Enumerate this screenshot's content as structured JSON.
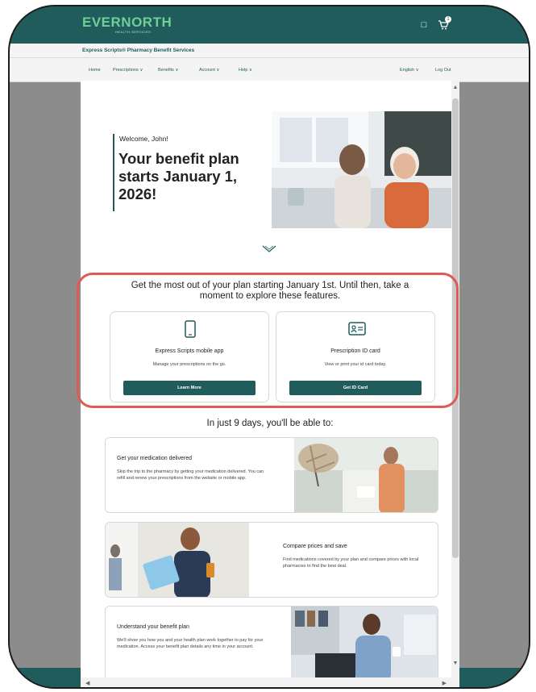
{
  "header": {
    "logo": "EVERNORTH",
    "logo_sub": "HEALTH SERVICES",
    "brand": "Express Scripts® Pharmacy Benefit Services",
    "nav": [
      "Home",
      "Prescriptions ∨",
      "Benefits ∨",
      "Account ∨",
      "Help ∨"
    ],
    "language": "English ∨",
    "logout": "Log Out",
    "icons": [
      "bell-icon",
      "cart-icon"
    ]
  },
  "hero": {
    "welcome": "Welcome, John!",
    "headline": "Your benefit plan starts January 1, 2026!"
  },
  "explore": {
    "text": "Get the most out of your plan starting January 1st. Until then, take a moment to explore these features."
  },
  "cards": [
    {
      "icon": "phone-icon",
      "title": "Express Scripts mobile app",
      "desc": "Manage your prescriptions on the go.",
      "button": "Learn More"
    },
    {
      "icon": "id-card-icon",
      "title": "Prescription ID card",
      "desc": "View or print your id card today.",
      "button": "Get ID Card"
    }
  ],
  "countdown": {
    "text": "In just 9 days, you'll be able to:"
  },
  "features": [
    {
      "title": "Get your medication delivered",
      "desc": "Skip the trip to the pharmacy by getting your medication delivered. You can refill and renew your prescriptions from the website or mobile app."
    },
    {
      "title": "Compare prices and save",
      "desc": "Find medications covered by your plan and compare prices with local pharmacies to find the best deal."
    },
    {
      "title": "Understand your benefit plan",
      "desc": "We'll show you how you and your health plan work together to pay for your medication. Access your benefit plan details any time in your account."
    }
  ],
  "colors": {
    "brand": "#1f5c5b",
    "accent": "#6fcf97",
    "highlight": "#e05a55",
    "overlay": "#8c8c8c"
  }
}
